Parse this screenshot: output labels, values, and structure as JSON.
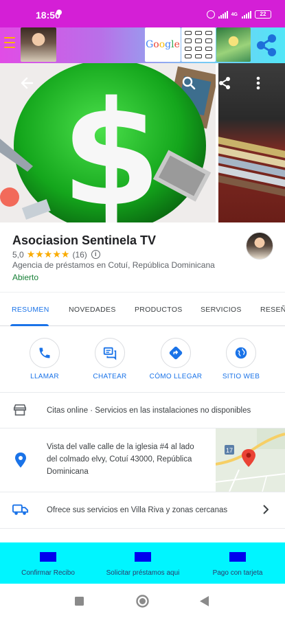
{
  "status_bar": {
    "time": "18:50",
    "network": "4G",
    "battery": "22"
  },
  "ad_banner": {
    "google_letters": [
      {
        "ch": "G",
        "color": "#4285f4"
      },
      {
        "ch": "o",
        "color": "#ea4335"
      },
      {
        "ch": "o",
        "color": "#fbbc05"
      },
      {
        "ch": "g",
        "color": "#4285f4"
      },
      {
        "ch": "l",
        "color": "#34a853"
      },
      {
        "ch": "e",
        "color": "#ea4335"
      }
    ],
    "share_icon": "share-icon",
    "menu_icon": "menu-icon"
  },
  "hero": {
    "back_icon": "arrow-back-icon",
    "search_icon": "search-icon",
    "share_icon": "share-icon",
    "more_icon": "more-vert-icon"
  },
  "place": {
    "name": "Asociasion Sentinela TV",
    "rating": "5,0",
    "stars": "★★★★★",
    "review_count": "(16)",
    "info_glyph": "i",
    "category": "Agencia de préstamos en Cotuí, República Dominicana",
    "status": "Abierto"
  },
  "tabs": [
    {
      "label": "RESUMEN",
      "active": true
    },
    {
      "label": "NOVEDADES",
      "active": false
    },
    {
      "label": "PRODUCTOS",
      "active": false
    },
    {
      "label": "SERVICIOS",
      "active": false
    },
    {
      "label": "RESEÑAS",
      "active": false
    }
  ],
  "actions": [
    {
      "label": "LLAMAR",
      "icon": "phone-icon"
    },
    {
      "label": "CHATEAR",
      "icon": "chat-icon"
    },
    {
      "label": "CÓMO LLEGAR",
      "icon": "directions-icon"
    },
    {
      "label": "SITIO WEB",
      "icon": "globe-icon"
    }
  ],
  "info_rows": {
    "booking": {
      "text": "Citas online · Servicios en las instalaciones no disponibles",
      "icon": "storefront-icon"
    },
    "address": {
      "line1": "Vista del valle calle de la iglesia #4 al lado",
      "line2": "del colmado elvy, Cotuí 43000, República",
      "line3": "Dominicana",
      "icon": "location-pin-icon"
    },
    "service_area": {
      "text": "Ofrece sus servicios en Villa Riva y zonas cercanas",
      "icon": "delivery-truck-icon"
    },
    "map": {
      "route_label": "17"
    }
  },
  "bottom_bar": {
    "background": "#00f5ff",
    "items": [
      {
        "label": "Confirmar Recibo"
      },
      {
        "label": "Solicitar préstamos aqui"
      },
      {
        "label": "Pago con tarjeta"
      }
    ]
  },
  "colors": {
    "accent": "#1a73e8",
    "status_bar": "#d41fd6",
    "stars": "#f9ab00",
    "open": "#188038",
    "pin": "#ea4335"
  }
}
